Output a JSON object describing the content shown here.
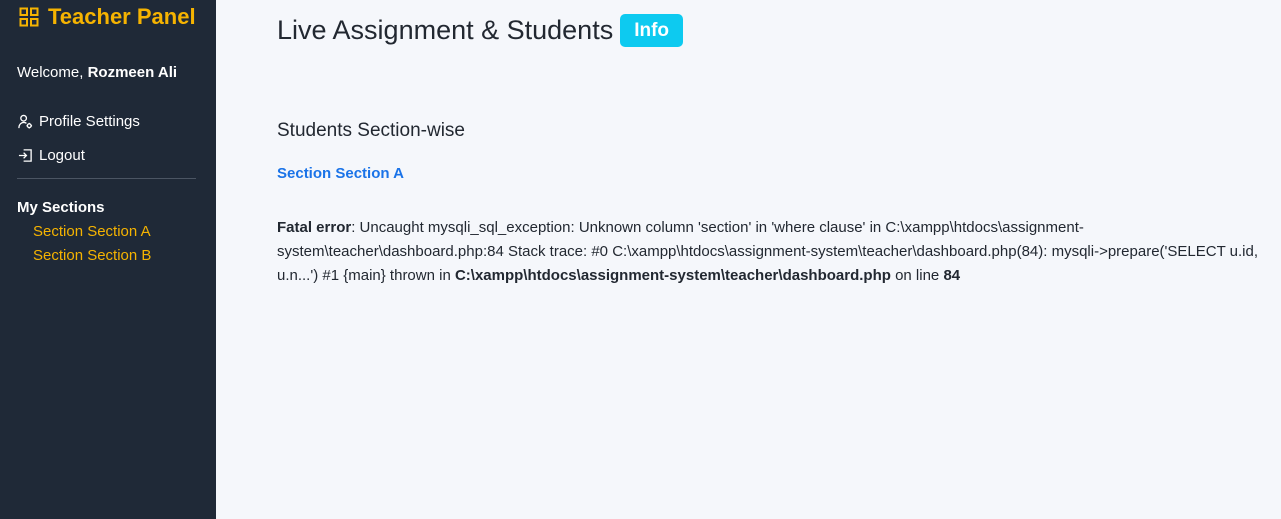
{
  "sidebar": {
    "brand": "Teacher Panel",
    "welcome_prefix": "Welcome, ",
    "user_name": "Rozmeen Ali",
    "nav": {
      "profile": "Profile Settings",
      "logout": "Logout"
    },
    "sections_heading": "My Sections",
    "sections": [
      "Section Section A",
      "Section Section B"
    ]
  },
  "main": {
    "title": "Live Assignment & Students",
    "badge": "Info",
    "subheading": "Students Section-wise",
    "section_link": "Section Section A",
    "error": {
      "label": "Fatal error",
      "message": ": Uncaught mysqli_sql_exception: Unknown column 'section' in 'where clause' in C:\\xampp\\htdocs\\assignment-system\\teacher\\dashboard.php:84 Stack trace: #0 C:\\xampp\\htdocs\\assignment-system\\teacher\\dashboard.php(84): mysqli->prepare('SELECT u.id, u.n...') #1 {main} thrown in ",
      "file": "C:\\xampp\\htdocs\\assignment-system\\teacher\\dashboard.php",
      "on_line": " on line ",
      "line": "84"
    }
  },
  "colors": {
    "sidebar_bg": "#1f2937",
    "accent": "#f5b301",
    "badge": "#0dcaf0",
    "link": "#1a73e8",
    "page_bg": "#f5f7fb"
  },
  "icons": {
    "brand": "grid-icon",
    "profile": "user-gear-icon",
    "logout": "logout-icon"
  }
}
